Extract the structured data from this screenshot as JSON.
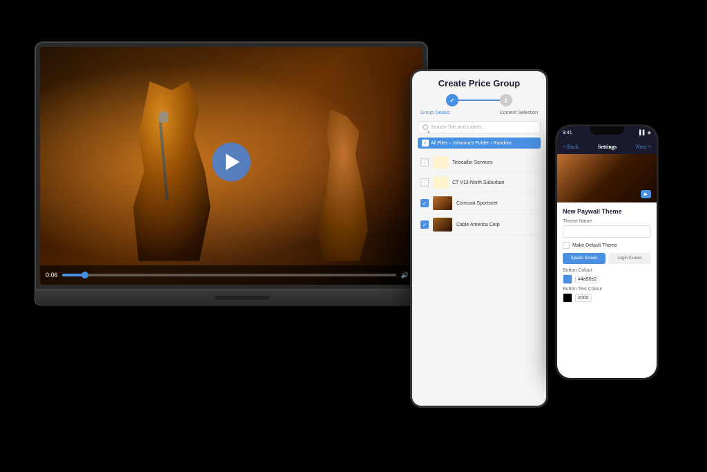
{
  "scene": {
    "background": "#000000"
  },
  "laptop": {
    "video": {
      "play_button_label": "Play",
      "time": "0:06",
      "progress_percent": 8
    }
  },
  "tablet": {
    "title": "Create Price Group",
    "steps": [
      {
        "label": "Group Details",
        "number": "1",
        "active": true
      },
      {
        "label": "Content Selection",
        "number": "2",
        "active": false
      }
    ],
    "search_placeholder": "Search Title and Labels...",
    "folder_path": "All Files › Johanna's Folder › Random",
    "files": [
      {
        "name": "Telecaller Services",
        "type": "folder",
        "checked": false
      },
      {
        "name": "CT V13-North Suburban",
        "type": "folder",
        "checked": false
      },
      {
        "name": "Comcast Sportsnet",
        "type": "video",
        "checked": true
      },
      {
        "name": "Cable America Corp",
        "type": "video",
        "checked": true
      }
    ]
  },
  "phone": {
    "status_bar": {
      "time": "9:41",
      "icons": "▌▌ WiFi ⬛"
    },
    "nav": {
      "back": "< Back",
      "title": "Settings",
      "next": "Next >"
    },
    "paywall_theme": {
      "title": "New Paywall Theme",
      "theme_name_label": "Theme Name",
      "theme_name_value": "",
      "default_label": "Make Default Theme",
      "splash_label": "Splash Screen",
      "login_label": "Login Screen",
      "button_color_label": "Button Colour",
      "button_color_swatch": "#4a90e2",
      "button_color_value": "#4a90e2",
      "button_text_color_label": "Button Text Colour",
      "button_text_color_value": "#000"
    }
  }
}
